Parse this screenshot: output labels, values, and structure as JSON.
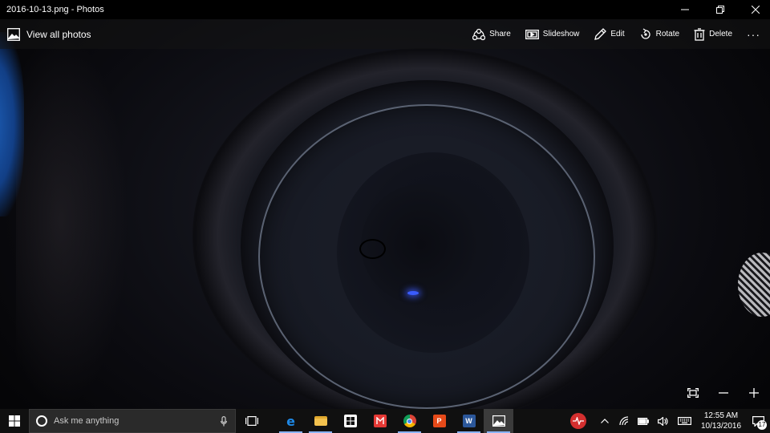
{
  "window": {
    "title": "2016-10-13.png - Photos"
  },
  "toolbar": {
    "view_all_label": "View all photos",
    "share_label": "Share",
    "slideshow_label": "Slideshow",
    "edit_label": "Edit",
    "rotate_label": "Rotate",
    "delete_label": "Delete",
    "more_label": "···"
  },
  "taskbar": {
    "search_placeholder": "Ask me anything",
    "apps": [
      {
        "name": "edge-icon",
        "color": "#1e88e5"
      },
      {
        "name": "file-explorer-icon",
        "color": "#f2c14e"
      },
      {
        "name": "store-icon",
        "color": "#ffffff"
      },
      {
        "name": "mail-app-icon",
        "color": "#e53935"
      },
      {
        "name": "chrome-icon",
        "color": "#4caf50"
      },
      {
        "name": "presentation-app-icon",
        "color": "#e64a19"
      },
      {
        "name": "word-icon",
        "color": "#2b579a"
      },
      {
        "name": "photos-icon",
        "color": "#ffffff"
      }
    ],
    "clock_time": "12:55 AM",
    "clock_date": "10/13/2016",
    "notification_count": "17"
  }
}
